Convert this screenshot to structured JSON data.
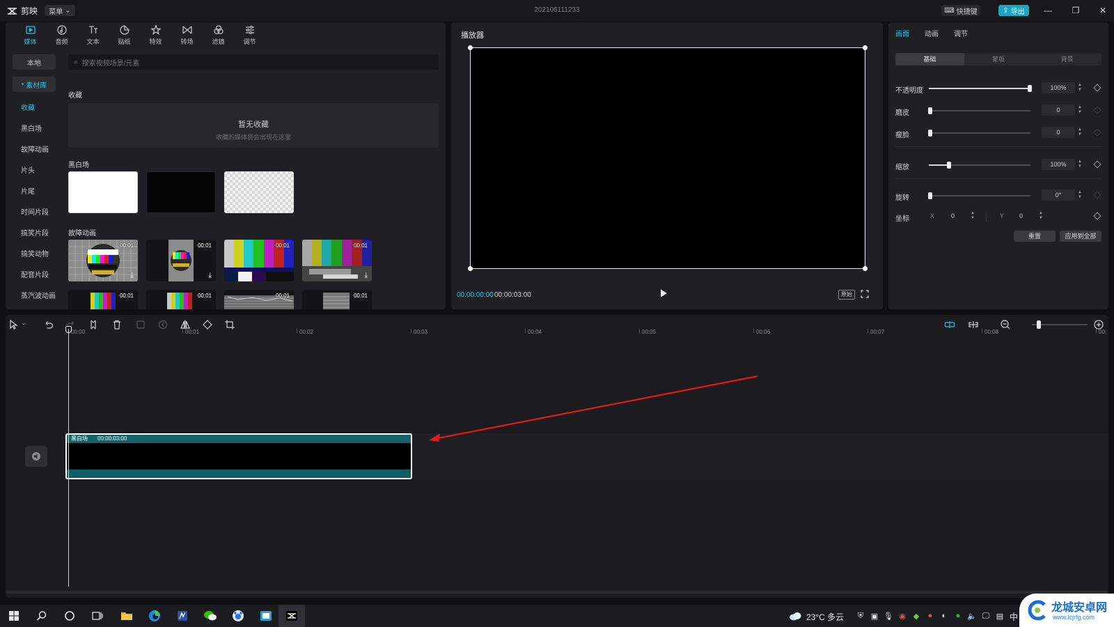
{
  "titlebar": {
    "app_name": "剪映",
    "menu_label": "菜单",
    "document_title": "202106111233",
    "shortcut_label": "快捷键",
    "export_label": "导出"
  },
  "media": {
    "tabs": [
      {
        "label": "媒体",
        "icon": "media-icon",
        "active": true
      },
      {
        "label": "音频",
        "icon": "audio-icon"
      },
      {
        "label": "文本",
        "icon": "text-icon"
      },
      {
        "label": "贴纸",
        "icon": "sticker-icon"
      },
      {
        "label": "特效",
        "icon": "effects-icon"
      },
      {
        "label": "转场",
        "icon": "transition-icon"
      },
      {
        "label": "滤镜",
        "icon": "filter-icon"
      },
      {
        "label": "调节",
        "icon": "adjust-icon"
      }
    ],
    "nav": {
      "local": "本地",
      "library": "素材库",
      "items": [
        "收藏",
        "黑白场",
        "故障动画",
        "片头",
        "片尾",
        "时间片段",
        "搞笑片段",
        "搞笑动物",
        "配音片段",
        "蒸汽波动画"
      ]
    },
    "search_placeholder": "搜索视频场景/元素",
    "favorites": {
      "heading": "收藏",
      "empty_title": "暂无收藏",
      "empty_sub": "收藏的媒体将会出现在这里"
    },
    "bw_heading": "黑白场",
    "glitch_heading": "故障动画",
    "clip_duration": "00:01"
  },
  "player": {
    "title": "播放器",
    "current_time": "00:00:00:00",
    "total_time": "00:00:03:00",
    "ratio_label": "原始"
  },
  "properties": {
    "tabs": [
      "画面",
      "动画",
      "调节"
    ],
    "segments": [
      "基础",
      "蒙版",
      "背景"
    ],
    "rows": [
      {
        "label": "不透明度",
        "value": "100%",
        "level": 1.0
      },
      {
        "label": "磨皮",
        "value": "0",
        "level": 0
      },
      {
        "label": "瘦脸",
        "value": "0",
        "level": 0
      },
      {
        "label": "缩放",
        "value": "100%",
        "level": 0.2
      },
      {
        "label": "旋转",
        "value": "0°",
        "level": 0
      }
    ],
    "position_label": "坐标",
    "x_label": "X",
    "x_value": "0",
    "y_label": "Y",
    "y_value": "0",
    "reset_label": "重置",
    "apply_all_label": "应用到全部"
  },
  "timeline": {
    "ticks": [
      "00:00",
      "00:01",
      "00:02",
      "00:03",
      "00:04",
      "00:05",
      "00:06",
      "00:07",
      "00:08",
      "00:"
    ],
    "clip_name": "黑白场",
    "clip_duration": "00:00:03:00",
    "annotation_color": "#e11b1b"
  },
  "taskbar": {
    "weather": "23°C 多云",
    "ime": "中"
  },
  "watermark": {
    "title": "龙城安卓网",
    "url": "www.lcjrfg.com"
  },
  "colors": {
    "accent": "#25c1e0",
    "clip": "#0e5e66"
  }
}
